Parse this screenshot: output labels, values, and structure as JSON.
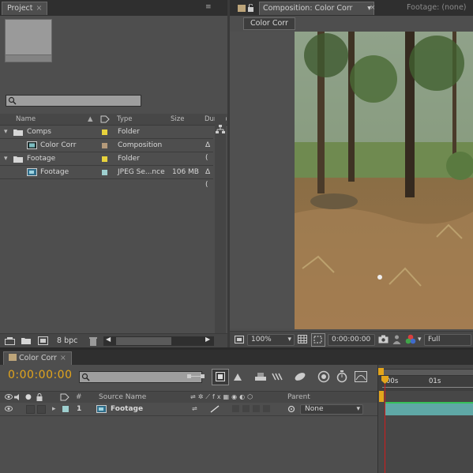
{
  "project": {
    "tab_label": "Project",
    "search_placeholder": "",
    "columns": [
      "Name",
      "Type",
      "Size",
      "Duration"
    ],
    "rows": [
      {
        "name": "Comps",
        "type": "Folder",
        "size": "",
        "duration": "",
        "label_color": "#e8d23c"
      },
      {
        "name": "Color Corr",
        "type": "Composition",
        "size": "",
        "duration": "Δ (",
        "label_color": "#b59a7a"
      },
      {
        "name": "Footage",
        "type": "Folder",
        "size": "",
        "duration": "",
        "label_color": "#e8d23c"
      },
      {
        "name": "Footage",
        "type": "JPEG Se...nce",
        "size": "106 MB",
        "duration": "Δ (",
        "label_color": "#9ecfcf"
      }
    ],
    "bit_depth": "8 bpc"
  },
  "composition": {
    "tab_label": "Composition: Color Corr",
    "footage_tab_label": "Footage: (none)",
    "breadcrumb": "Color Corr",
    "zoom": "100%",
    "timecode": "0:00:00:00",
    "resolution": "Full"
  },
  "timeline": {
    "tab_label": "Color Corr",
    "current_time": "0:00:00:00",
    "search_placeholder": "",
    "columns": {
      "source_name": "Source Name",
      "parent": "Parent",
      "number": "#"
    },
    "ruler": {
      "start": "00s",
      "mark": "01s"
    },
    "layers": [
      {
        "number": "1",
        "name": "Footage",
        "parent": "None",
        "label_color": "#9ecfcf"
      }
    ]
  },
  "colors": {
    "accent_time": "#e3a51c",
    "layer_bar": "#5fa8a6",
    "playhead": "#d21b1b",
    "panel_bg": "#4e4e4e"
  }
}
